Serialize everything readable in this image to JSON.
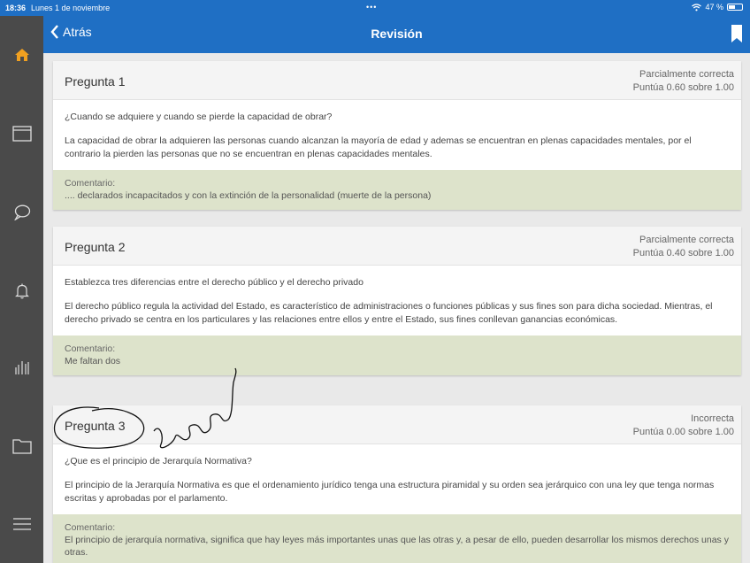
{
  "status_bar": {
    "time": "18:36",
    "date": "Lunes 1 de noviembre",
    "dots": "•••",
    "battery": "47 %"
  },
  "sidebar": {
    "items": [
      "home-icon",
      "window-icon",
      "chat-icon",
      "bell-icon",
      "chart-icon",
      "folder-icon",
      "menu-icon"
    ]
  },
  "navbar": {
    "back_label": "Atrás",
    "title": "Revisión"
  },
  "questions": [
    {
      "title": "Pregunta 1",
      "state": "Parcialmente correcta",
      "score": "Puntúa 0.60 sobre 1.00",
      "question": "¿Cuando se adquiere y cuando se pierde  la capacidad de obrar?",
      "answer": "La capacidad de obrar la adquieren las personas cuando alcanzan la mayoría de edad y ademas se encuentran en plenas capacidades mentales, por el contrario la pierden las personas que no se encuentran en plenas capacidades mentales.",
      "comment_label": "Comentario:",
      "comment": ".... declarados incapacitados y con la extinción de la personalidad (muerte de la persona)"
    },
    {
      "title": "Pregunta 2",
      "state": "Parcialmente correcta",
      "score": "Puntúa 0.40 sobre 1.00",
      "question": "Establezca tres diferencias entre el derecho público y el derecho privado",
      "answer": "El derecho público regula la actividad del Estado, es característico de administraciones o funciones públicas y sus fines son para dicha sociedad. Mientras, el derecho privado se centra en los particulares y las relaciones entre ellos y entre el Estado, sus fines conllevan ganancias económicas.",
      "comment_label": "Comentario:",
      "comment": "Me faltan dos"
    },
    {
      "title": "Pregunta 3",
      "state": "Incorrecta",
      "score": "Puntúa 0.00 sobre 1.00",
      "question": "¿Que es el principio de Jerarquía Normativa?",
      "answer": "El principio de la Jerarquía Normativa es que el ordenamiento jurídico tenga una estructura piramidal y su orden sea jerárquico con una ley que tenga normas escritas y aprobadas por el parlamento.",
      "comment_label": "Comentario:",
      "comment": "El principio de jerarquía normativa, significa que hay leyes más importantes unas que las otras y, a pesar de ello, pueden desarrollar los mismos derechos unas y otras."
    }
  ],
  "colors": {
    "primary": "#1f6fc4",
    "sidebar": "#4a4a4a",
    "home_accent": "#f0a020",
    "comment_bg": "#dde3cb"
  }
}
